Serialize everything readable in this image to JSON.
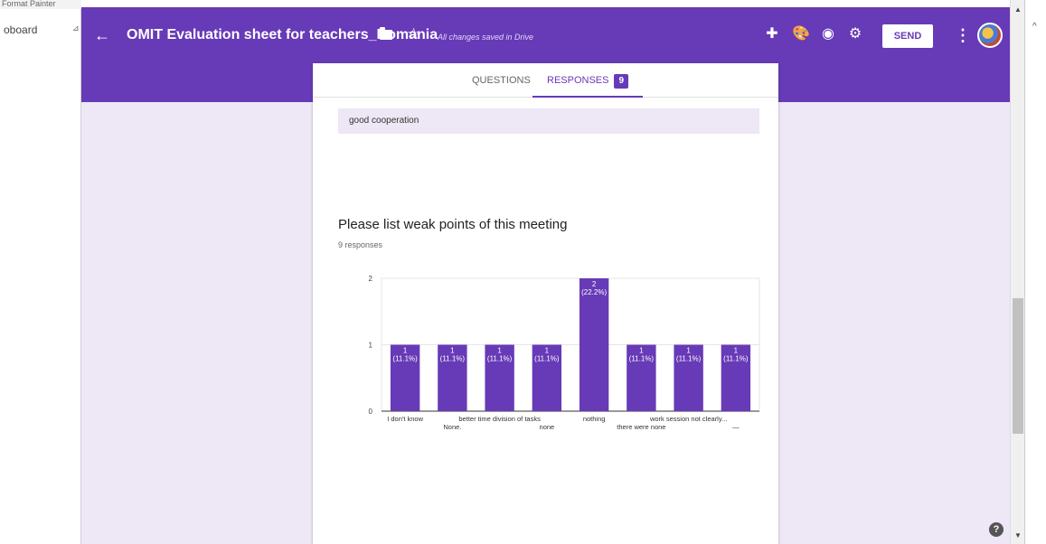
{
  "host": {
    "clipboard_label": "oboard",
    "top_fragment": "Format Painter",
    "launcher_glyph": "⊿"
  },
  "toolbar": {
    "back_glyph": "←",
    "title": "OMIT Evaluation sheet for teachers_Romania",
    "star_glyph": "☆",
    "saved_status": "All changes saved in Drive",
    "addons_glyph": "✚",
    "palette_glyph": "🎨",
    "preview_glyph": "◉",
    "settings_glyph": "⚙",
    "send_label": "SEND",
    "more_glyph": "⋮"
  },
  "tabs": {
    "questions_label": "QUESTIONS",
    "responses_label": "RESPONSES",
    "responses_count": "9"
  },
  "prev_answer": "good cooperation",
  "question": {
    "title": "Please list weak points of this meeting",
    "response_count": "9 responses"
  },
  "colors": {
    "accent": "#673ab7",
    "background": "#ede7f6"
  },
  "chart_data": {
    "type": "bar",
    "categories": [
      "I don't know",
      "None.",
      "better time division of tasks",
      "none",
      "nothing",
      "there were none",
      "work session not clearly...",
      "—"
    ],
    "values": [
      1,
      1,
      1,
      1,
      2,
      1,
      1,
      1
    ],
    "bar_labels": [
      "1\n(11.1%)",
      "1\n(11.1%)",
      "1\n(11.1%)",
      "1\n(11.1%)",
      "2\n(22.2%)",
      "1\n(11.1%)",
      "1\n(11.1%)",
      "1\n(11.1%)"
    ],
    "yticks": [
      0,
      1,
      2
    ],
    "ylim": [
      0,
      2
    ],
    "title": "",
    "xlabel": "",
    "ylabel": "",
    "grid": true,
    "bar_color": "#673ab7"
  },
  "help_glyph": "?",
  "scrollbar": {
    "up_glyph": "▲",
    "down_glyph": "▼"
  }
}
